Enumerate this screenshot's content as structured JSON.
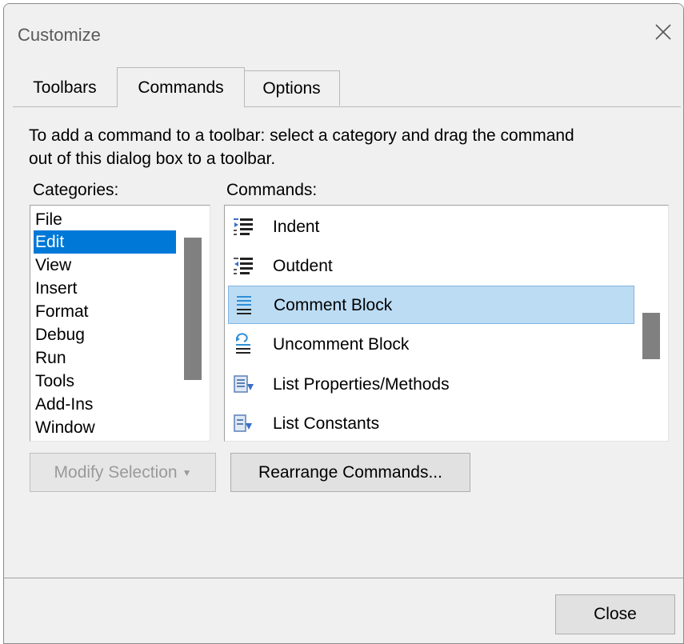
{
  "dialog": {
    "title": "Customize"
  },
  "tabs": [
    {
      "label": "Toolbars"
    },
    {
      "label": "Commands"
    },
    {
      "label": "Options"
    }
  ],
  "commands_tab": {
    "instructions_line1": "To add a command to a toolbar: select a category and drag the command",
    "instructions_line2": "out of this dialog box to a toolbar.",
    "categories_label": "Categories:",
    "commands_label": "Commands:",
    "categories": [
      "File",
      "Edit",
      "View",
      "Insert",
      "Format",
      "Debug",
      "Run",
      "Tools",
      "Add-Ins",
      "Window"
    ],
    "selected_category": "Edit",
    "commands": [
      {
        "label": "Indent",
        "icon": "indent-icon"
      },
      {
        "label": "Outdent",
        "icon": "outdent-icon"
      },
      {
        "label": "Comment Block",
        "icon": "comment-block-icon"
      },
      {
        "label": "Uncomment Block",
        "icon": "uncomment-block-icon"
      },
      {
        "label": "List Properties/Methods",
        "icon": "list-properties-icon"
      },
      {
        "label": "List Constants",
        "icon": "list-constants-icon"
      }
    ],
    "selected_command": "Comment Block",
    "modify_selection_label": "Modify Selection",
    "rearrange_label": "Rearrange Commands..."
  },
  "footer": {
    "close_label": "Close"
  },
  "colors": {
    "selection_blue": "#0078d7",
    "command_highlight": "#bcdcf4"
  }
}
